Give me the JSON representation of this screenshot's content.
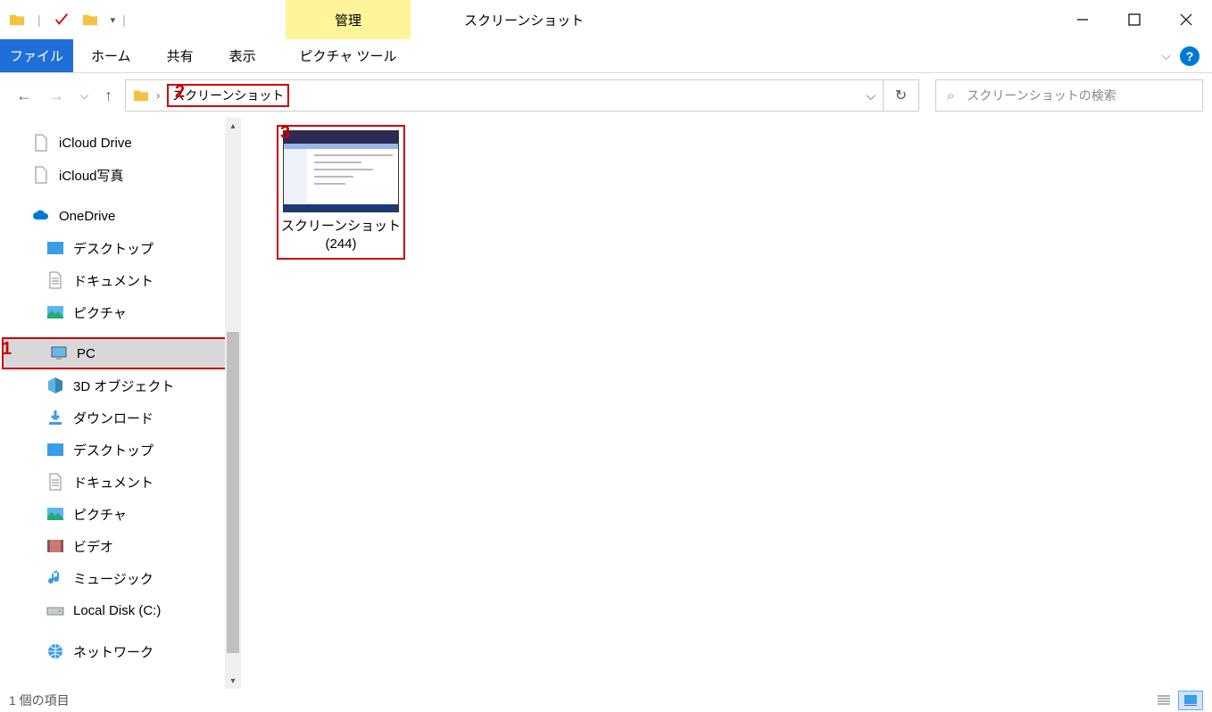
{
  "window": {
    "title": "スクリーンショット",
    "manage_label": "管理"
  },
  "ribbon": {
    "file": "ファイル",
    "tabs": [
      "ホーム",
      "共有",
      "表示"
    ],
    "context_tab": "ピクチャ ツール"
  },
  "address": {
    "current": "スクリーンショット"
  },
  "search": {
    "placeholder": "スクリーンショットの検索"
  },
  "sidebar": {
    "items": [
      {
        "label": "iCloud Drive",
        "icon": "doc",
        "indent": 0
      },
      {
        "label": "iCloud写真",
        "icon": "doc",
        "indent": 0
      },
      {
        "label": "OneDrive",
        "icon": "cloud",
        "indent": 0
      },
      {
        "label": "デスクトップ",
        "icon": "folder-blue",
        "indent": 1
      },
      {
        "label": "ドキュメント",
        "icon": "doc-lines",
        "indent": 1
      },
      {
        "label": "ピクチャ",
        "icon": "pic",
        "indent": 1
      },
      {
        "label": "PC",
        "icon": "pc",
        "indent": 1,
        "selected": true
      },
      {
        "label": "3D オブジェクト",
        "icon": "3d",
        "indent": 1
      },
      {
        "label": "ダウンロード",
        "icon": "download",
        "indent": 1
      },
      {
        "label": "デスクトップ",
        "icon": "folder-blue",
        "indent": 1
      },
      {
        "label": "ドキュメント",
        "icon": "doc-lines",
        "indent": 1
      },
      {
        "label": "ピクチャ",
        "icon": "pic",
        "indent": 1
      },
      {
        "label": "ビデオ",
        "icon": "video",
        "indent": 1
      },
      {
        "label": "ミュージック",
        "icon": "music",
        "indent": 1
      },
      {
        "label": "Local Disk (C:)",
        "icon": "disk",
        "indent": 1
      },
      {
        "label": "ネットワーク",
        "icon": "network",
        "indent": 1
      }
    ]
  },
  "files": [
    {
      "name_line1": "スクリーンショット",
      "name_line2": "(244)"
    }
  ],
  "status": {
    "text": "1 個の項目"
  },
  "annotations": {
    "a1": "1",
    "a2": "2",
    "a3": "3"
  }
}
